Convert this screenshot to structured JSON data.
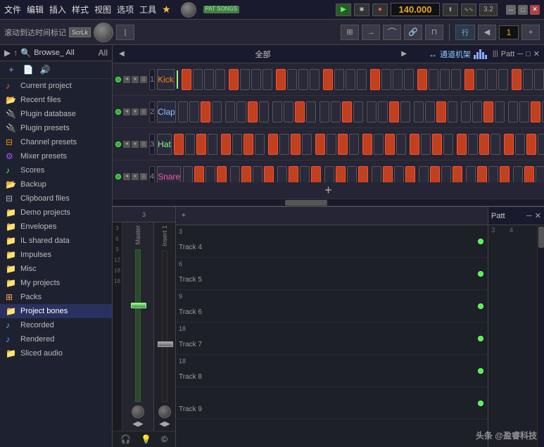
{
  "titlebar": {
    "menus": [
      "文件",
      "编辑",
      "插入",
      "样式",
      "视图",
      "选项",
      "工具"
    ],
    "star": "★",
    "pat_badge": "PAT\nSONGS",
    "bpm": "140.000",
    "version": "3.2",
    "window_min": "─",
    "window_max": "□",
    "window_close": "✕"
  },
  "toolbar": {
    "scroll_label": "滚动到达时间标记",
    "scrlock": "ScrLk",
    "row_label": "行",
    "row_num": "1"
  },
  "sidebar": {
    "browse_label": "Browse_ All",
    "items": [
      {
        "id": "current-project",
        "icon": "🎵",
        "icon_class": "red",
        "label": "Current project"
      },
      {
        "id": "recent-files",
        "icon": "📂",
        "icon_class": "teal",
        "label": "Recent files"
      },
      {
        "id": "plugin-database",
        "icon": "🔌",
        "icon_class": "blue",
        "label": "Plugin database"
      },
      {
        "id": "plugin-presets",
        "icon": "🔌",
        "icon_class": "blue",
        "label": "Plugin presets"
      },
      {
        "id": "channel-presets",
        "icon": "📋",
        "icon_class": "orange",
        "label": "Channel presets"
      },
      {
        "id": "mixer-presets",
        "icon": "🎛",
        "icon_class": "purple",
        "label": "Mixer presets"
      },
      {
        "id": "scores",
        "icon": "♪",
        "icon_class": "green",
        "label": "Scores"
      },
      {
        "id": "backup",
        "icon": "📂",
        "icon_class": "teal",
        "label": "Backup"
      },
      {
        "id": "clipboard-files",
        "icon": "📋",
        "icon_class": "",
        "label": "Clipboard files"
      },
      {
        "id": "demo-projects",
        "icon": "📁",
        "icon_class": "",
        "label": "Demo projects"
      },
      {
        "id": "envelopes",
        "icon": "📁",
        "icon_class": "",
        "label": "Envelopes"
      },
      {
        "id": "il-shared-data",
        "icon": "📁",
        "icon_class": "",
        "label": "IL shared data"
      },
      {
        "id": "impulses",
        "icon": "📁",
        "icon_class": "",
        "label": "Impulses"
      },
      {
        "id": "misc",
        "icon": "📁",
        "icon_class": "",
        "label": "Misc"
      },
      {
        "id": "my-projects",
        "icon": "📁",
        "icon_class": "",
        "label": "My projects"
      },
      {
        "id": "packs",
        "icon": "🎒",
        "icon_class": "yellow",
        "label": "Packs"
      },
      {
        "id": "project-bones",
        "icon": "📁",
        "icon_class": "",
        "label": "Project bones"
      },
      {
        "id": "recorded",
        "icon": "🎵",
        "icon_class": "blue",
        "label": "Recorded"
      },
      {
        "id": "rendered",
        "icon": "🎵",
        "icon_class": "blue",
        "label": "Rendered"
      },
      {
        "id": "sliced-audio",
        "icon": "📁",
        "icon_class": "",
        "label": "Sliced audio"
      }
    ]
  },
  "pattern": {
    "header_left": "全部",
    "header_channel": "通道机架",
    "header_right": "Patt",
    "add_btn": "+",
    "drum_rows": [
      {
        "num": "1",
        "name": "Kick",
        "name_class": "kick",
        "active": true,
        "steps": [
          1,
          0,
          0,
          0,
          1,
          0,
          0,
          0,
          1,
          0,
          0,
          0,
          1,
          0,
          0,
          0,
          1,
          0,
          0,
          0,
          1,
          0,
          0,
          0,
          1,
          0,
          0,
          0,
          1,
          0,
          0,
          0
        ]
      },
      {
        "num": "2",
        "name": "Clap",
        "name_class": "clap",
        "active": true,
        "steps": [
          0,
          0,
          1,
          0,
          0,
          0,
          1,
          0,
          0,
          0,
          1,
          0,
          0,
          0,
          1,
          0,
          0,
          0,
          1,
          0,
          0,
          0,
          1,
          0,
          0,
          0,
          1,
          0,
          0,
          0,
          1,
          0
        ]
      },
      {
        "num": "3",
        "name": "Hat",
        "name_class": "hat",
        "active": true,
        "steps": [
          1,
          0,
          1,
          0,
          1,
          0,
          1,
          0,
          1,
          0,
          1,
          0,
          1,
          0,
          1,
          0,
          1,
          0,
          1,
          0,
          1,
          0,
          1,
          0,
          1,
          0,
          1,
          0,
          1,
          0,
          1,
          0
        ]
      },
      {
        "num": "4",
        "name": "Snare",
        "name_class": "snare",
        "active": true,
        "steps": [
          0,
          1,
          0,
          1,
          0,
          1,
          0,
          1,
          0,
          1,
          0,
          1,
          0,
          1,
          0,
          1,
          0,
          1,
          0,
          1,
          0,
          1,
          0,
          1,
          0,
          1,
          0,
          1,
          0,
          1,
          0,
          1
        ]
      }
    ]
  },
  "mixer": {
    "master_label": "Master",
    "insert_label": "Insert 1"
  },
  "playlist": {
    "tracks": [
      {
        "label": "Track 4",
        "num": "3"
      },
      {
        "label": "Track 5",
        "num": "6"
      },
      {
        "label": "Track 6",
        "num": "9"
      },
      {
        "label": "Track 7",
        "num": "18"
      },
      {
        "label": "Track 8",
        "num": "18"
      },
      {
        "label": "Track 9",
        "num": ""
      }
    ]
  },
  "right_panel": {
    "label": "Patt",
    "nums": [
      "3",
      "4"
    ]
  },
  "watermark": "头条 @盈睿科技"
}
